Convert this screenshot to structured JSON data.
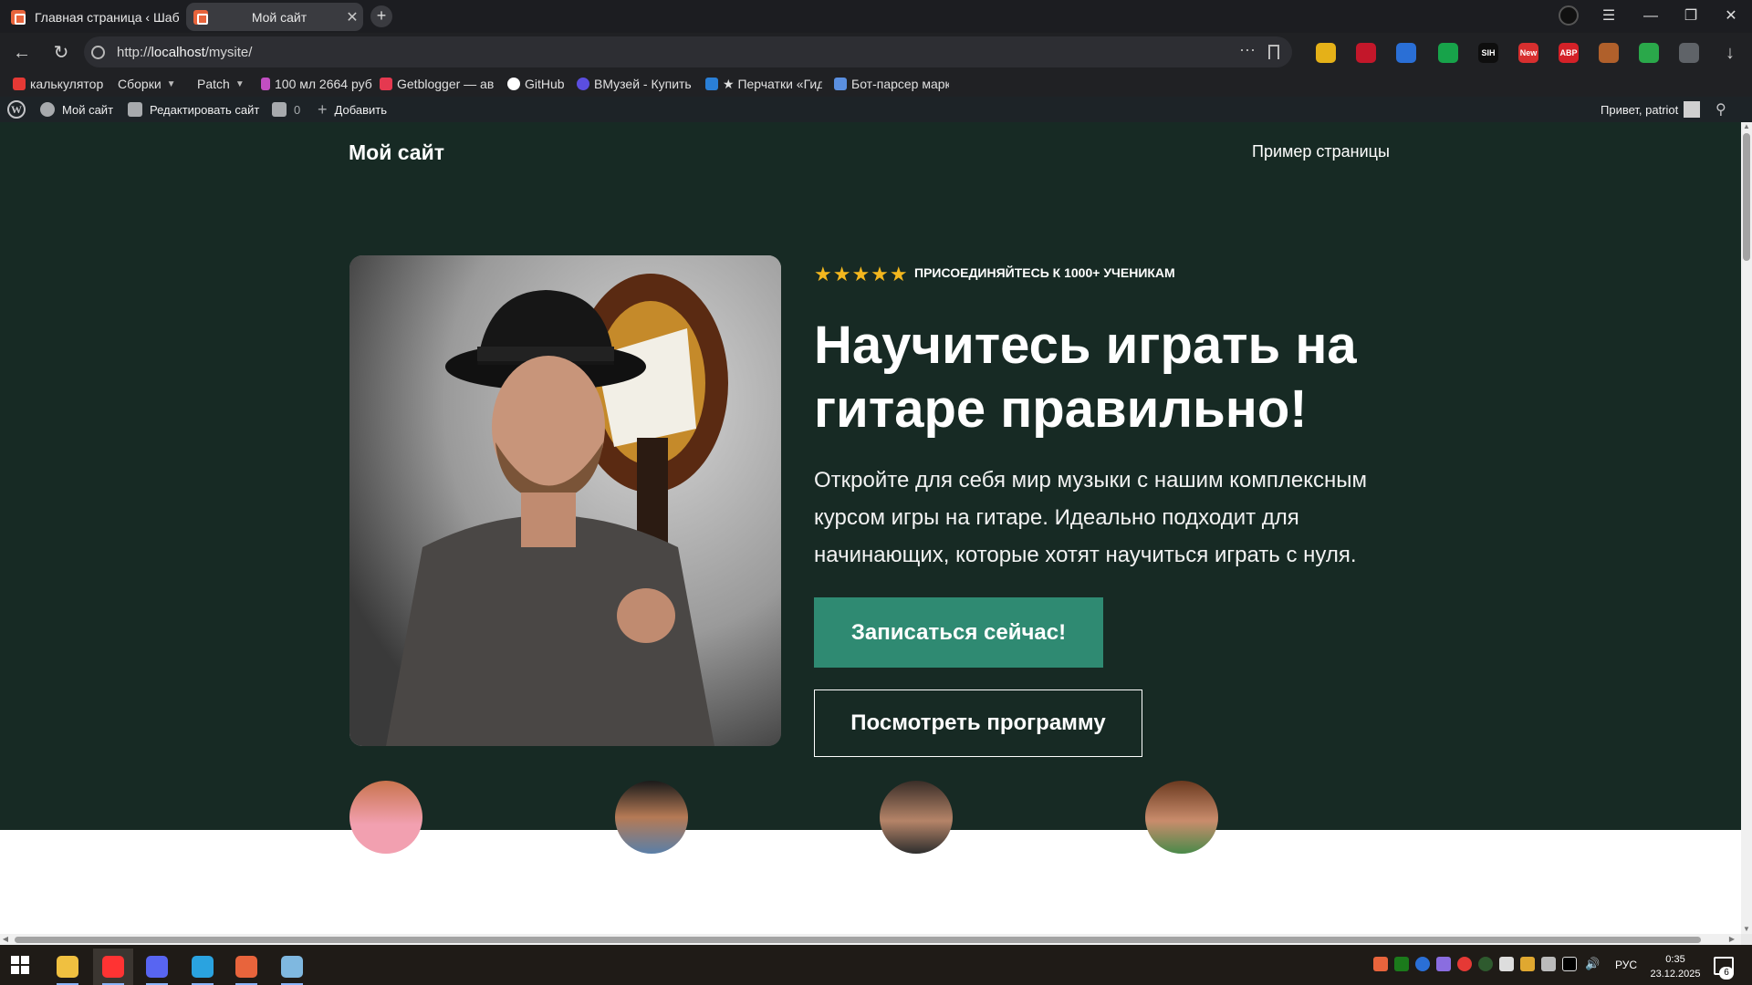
{
  "browser": {
    "tabs": [
      {
        "title": "Главная страница ‹ Шабл",
        "active": false
      },
      {
        "title": "Мой сайт",
        "active": true
      }
    ],
    "new_tab": "+",
    "window_controls": {
      "menu": "☰",
      "minimize": "—",
      "restore": "❐",
      "close": "✕"
    },
    "address": {
      "scheme": "http://",
      "host": "localhost",
      "path": "/mysite/"
    },
    "omni_more": "⋯",
    "nav": {
      "back": "←",
      "reload": "↻",
      "downloads": "↓"
    },
    "extensions": [
      {
        "name": "yandex-coin-extension-icon",
        "color": "#e5b118",
        "text": ""
      },
      {
        "name": "record-extension-icon",
        "color": "#c3172a",
        "text": ""
      },
      {
        "name": "translate-extension-icon",
        "color": "#2a6fd6",
        "text": ""
      },
      {
        "name": "wa-extension-icon",
        "color": "#17a34a",
        "text": ""
      },
      {
        "name": "sih-extension-icon",
        "color": "#0e0e0e",
        "text": "SIH"
      },
      {
        "name": "new-extension-icon",
        "color": "#d72f2f",
        "text": "New"
      },
      {
        "name": "adblock-extension-icon",
        "color": "#d42128",
        "text": "ABP"
      },
      {
        "name": "cookie-extension-icon",
        "color": "#b0602b",
        "text": ""
      },
      {
        "name": "shield-extension-icon",
        "color": "#2aa84a",
        "text": ""
      },
      {
        "name": "collections-extension-icon",
        "color": "#5f6368",
        "text": ""
      }
    ],
    "bookmarks": [
      {
        "label": "калькулятор",
        "color": "#e53935",
        "folder": false
      },
      {
        "label": "Сборки",
        "color": "",
        "folder": true
      },
      {
        "label": "Patch",
        "color": "",
        "folder": true
      },
      {
        "label": "100 мл 2664 руб",
        "color": "#c24ec2",
        "folder": false
      },
      {
        "label": "Getblogger — авт",
        "color": "#e53950",
        "folder": false
      },
      {
        "label": "GitHub",
        "color": "#ffffff",
        "folder": false
      },
      {
        "label": "ВМузей - Купить",
        "color": "#5b4ee0",
        "folder": false
      },
      {
        "label": "★ Перчатки «Гид",
        "color": "#2a7fd6",
        "folder": false
      },
      {
        "label": "Бот-парсер марк",
        "color": "#5a8fe0",
        "folder": false
      }
    ]
  },
  "wp_admin_bar": {
    "logo": "W",
    "site_name": "Мой сайт",
    "edit_site": "Редактировать сайт",
    "comments_count": "0",
    "add_new": "Добавить",
    "greeting": "Привет, patriot"
  },
  "site": {
    "title": "Мой сайт",
    "nav_link": "Пример страницы",
    "hero": {
      "stars": "★★★★★",
      "badge_text": "ПРИСОЕДИНЯЙТЕСЬ К 1000+ УЧЕНИКАМ",
      "headline": "Научитесь играть на гитаре правильно!",
      "lead": "Откройте для себя мир музыки с нашим комплексным курсом игры на гитаре. Идеально подходит для начинающих, которые хотят научиться играть с нуля.",
      "primary_cta": "Записаться сейчас!",
      "secondary_cta": "Посмотреть программу"
    },
    "colors": {
      "hero_bg": "#172a24",
      "primary_button": "#2f8a72",
      "stars": "#f3b71e"
    }
  },
  "taskbar": {
    "apps": [
      {
        "name": "file-explorer-taskbar-icon",
        "color": "#f0c040",
        "active": false
      },
      {
        "name": "yandex-browser-taskbar-icon",
        "color": "#f33",
        "active": true
      },
      {
        "name": "discord-taskbar-icon",
        "color": "#5865f2",
        "active": false
      },
      {
        "name": "telegram-taskbar-icon",
        "color": "#2aa3e0",
        "active": false
      },
      {
        "name": "xampp-taskbar-icon",
        "color": "#e8643c",
        "active": false
      },
      {
        "name": "notepad-taskbar-icon",
        "color": "#7fb8e0",
        "active": false
      }
    ],
    "language": "РУС",
    "time": "0:35",
    "date": "23.12.2025",
    "notifications": "6"
  }
}
